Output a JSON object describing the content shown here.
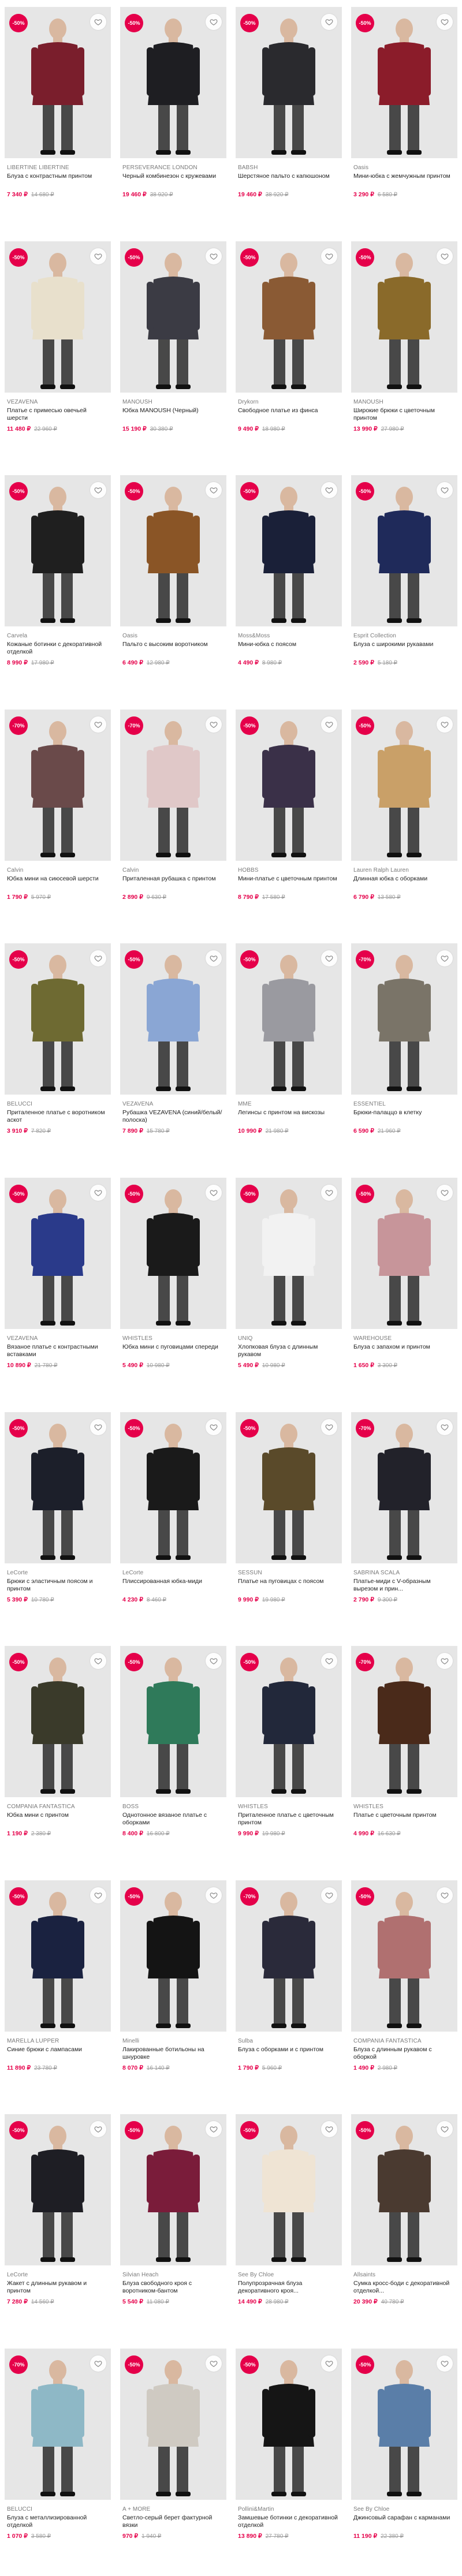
{
  "colors": {
    "accent": "#e5004a",
    "photo_bg": "#e6e6e6"
  },
  "products": [
    {
      "badge": "-50%",
      "brand": "LIBERTINE LIBERTINE",
      "title": "Блуза с контрастным принтом",
      "price": "7 340 ₽",
      "old_price": "14 680 ₽",
      "color": "#7a1e2c"
    },
    {
      "badge": "-50%",
      "brand": "PERSEVERANCE LONDON",
      "title": "Черный комбинезон с кружевами",
      "price": "19 460 ₽",
      "old_price": "38 920 ₽",
      "color": "#1e1e22"
    },
    {
      "badge": "-50%",
      "brand": "BABSH",
      "title": "Шерстяное пальто с капюшоном",
      "price": "19 460 ₽",
      "old_price": "38 920 ₽",
      "color": "#2a2a2e"
    },
    {
      "badge": "-50%",
      "brand": "Oasis",
      "title": "Мини-юбка с жемчужным принтом",
      "price": "3 290 ₽",
      "old_price": "6 580 ₽",
      "color": "#8b1c2a"
    },
    {
      "badge": "-50%",
      "brand": "VEZAVENA",
      "title": "Платье с примесью овечьей шерсти",
      "price": "11 480 ₽",
      "old_price": "22 960 ₽",
      "color": "#e8e0cc"
    },
    {
      "badge": "-50%",
      "brand": "MANOUSH",
      "title": "Юбка MANOUSH (Черный)",
      "price": "15 190 ₽",
      "old_price": "30 380 ₽",
      "color": "#3b3b44"
    },
    {
      "badge": "-50%",
      "brand": "Drykorn",
      "title": "Свободное платье из финса",
      "price": "9 490 ₽",
      "old_price": "18 980 ₽",
      "color": "#8a5a34"
    },
    {
      "badge": "-50%",
      "brand": "MANOUSH",
      "title": "Широкие брюки с цветочным принтом",
      "price": "13 990 ₽",
      "old_price": "27 980 ₽",
      "color": "#8a6a2a"
    },
    {
      "badge": "-50%",
      "brand": "Carvela",
      "title": "Кожаные ботинки с декоративной отделкой",
      "price": "8 990 ₽",
      "old_price": "17 980 ₽",
      "color": "#1f1f1f"
    },
    {
      "badge": "-50%",
      "brand": "Oasis",
      "title": "Пальто с высоким воротником",
      "price": "6 490 ₽",
      "old_price": "12 980 ₽",
      "color": "#8a5526"
    },
    {
      "badge": "-50%",
      "brand": "Moss&Moss",
      "title": "Мини-юбка с поясом",
      "price": "4 490 ₽",
      "old_price": "8 980 ₽",
      "color": "#1a2038"
    },
    {
      "badge": "-50%",
      "brand": "Esprit Collection",
      "title": "Блуза с широкими рукавами",
      "price": "2 590 ₽",
      "old_price": "5 180 ₽",
      "color": "#1f2a5a"
    },
    {
      "badge": "-70%",
      "brand": "Calvin",
      "title": "Юбка мини на сиюсевой шерсти",
      "price": "1 790 ₽",
      "old_price": "5 970 ₽",
      "color": "#6a4a4a"
    },
    {
      "badge": "-70%",
      "brand": "Calvin",
      "title": "Приталенная рубашка с принтом",
      "price": "2 890 ₽",
      "old_price": "9 630 ₽",
      "color": "#e0c8c8"
    },
    {
      "badge": "-50%",
      "brand": "HOBBS",
      "title": "Мини-платье с цветочным принтом",
      "price": "8 790 ₽",
      "old_price": "17 580 ₽",
      "color": "#3a3048"
    },
    {
      "badge": "-50%",
      "brand": "Lauren Ralph Lauren",
      "title": "Длинная юбка с оборками",
      "price": "6 790 ₽",
      "old_price": "13 580 ₽",
      "color": "#c9a068"
    },
    {
      "badge": "-50%",
      "brand": "BELUCCI",
      "title": "Приталенное платье с воротником аскот",
      "price": "3 910 ₽",
      "old_price": "7 820 ₽",
      "color": "#6e6a32"
    },
    {
      "badge": "-50%",
      "brand": "VEZAVENA",
      "title": "Рубашка VEZAVENA (синий/белый/полоска)",
      "price": "7 890 ₽",
      "old_price": "15 780 ₽",
      "color": "#8aa6d4"
    },
    {
      "badge": "-50%",
      "brand": "MME",
      "title": "Легинсы с принтом на вискозы",
      "price": "10 990 ₽",
      "old_price": "21 980 ₽",
      "color": "#9a9aa0"
    },
    {
      "badge": "-70%",
      "brand": "ESSENTIEL",
      "title": "Брюки-палаццо в клетку",
      "price": "6 590 ₽",
      "old_price": "21 960 ₽",
      "color": "#7a7468"
    },
    {
      "badge": "-50%",
      "brand": "VEZAVENA",
      "title": "Вязаное платье с контрастными вставками",
      "price": "10 890 ₽",
      "old_price": "21 780 ₽",
      "color": "#2a3a8a"
    },
    {
      "badge": "-50%",
      "brand": "WHISTLES",
      "title": "Юбка мини с пуговицами спереди",
      "price": "5 490 ₽",
      "old_price": "10 980 ₽",
      "color": "#1a1a1a"
    },
    {
      "badge": "-50%",
      "brand": "UNIQ",
      "title": "Хлопковая блуза с длинным рукавом",
      "price": "5 490 ₽",
      "old_price": "10 980 ₽",
      "color": "#f2f2f2"
    },
    {
      "badge": "-50%",
      "brand": "WAREHOUSE",
      "title": "Блуза с запахом и принтом",
      "price": "1 650 ₽",
      "old_price": "3 300 ₽",
      "color": "#c7959a"
    },
    {
      "badge": "-50%",
      "brand": "LeCorte",
      "title": "Брюки с эластичным поясом и принтом",
      "price": "5 390 ₽",
      "old_price": "10 780 ₽",
      "color": "#1c1f2a"
    },
    {
      "badge": "-50%",
      "brand": "LeCorte",
      "title": "Плиссированная юбка-миди",
      "price": "4 230 ₽",
      "old_price": "8 460 ₽",
      "color": "#1a1a1a"
    },
    {
      "badge": "-50%",
      "brand": "SESSUN",
      "title": "Платье на пуговицах с поясом",
      "price": "9 990 ₽",
      "old_price": "19 980 ₽",
      "color": "#5a4a2a"
    },
    {
      "badge": "-70%",
      "brand": "SABRINA SCALA",
      "title": "Платье-миди с V-образным вырезом и прин...",
      "price": "2 790 ₽",
      "old_price": "9 300 ₽",
      "color": "#22222a"
    },
    {
      "badge": "-50%",
      "brand": "COMPANIA FANTASTICA",
      "title": "Юбка мини с принтом",
      "price": "1 190 ₽",
      "old_price": "2 380 ₽",
      "color": "#3a3a2a"
    },
    {
      "badge": "-50%",
      "brand": "BOSS",
      "title": "Однотонное вязаное платье с оборками",
      "price": "8 400 ₽",
      "old_price": "16 800 ₽",
      "color": "#2f7a5a"
    },
    {
      "badge": "-50%",
      "brand": "WHISTLES",
      "title": "Приталенное платье с цветочным принтом",
      "price": "9 990 ₽",
      "old_price": "19 980 ₽",
      "color": "#22283a"
    },
    {
      "badge": "-70%",
      "brand": "WHISTLES",
      "title": "Платье с цветочным принтом",
      "price": "4 990 ₽",
      "old_price": "16 630 ₽",
      "color": "#4a2a1a"
    },
    {
      "badge": "-50%",
      "brand": "MARELLA LUPPER",
      "title": "Синие брюки с лампасами",
      "price": "11 890 ₽",
      "old_price": "23 780 ₽",
      "color": "#1a2240"
    },
    {
      "badge": "-50%",
      "brand": "Minelli",
      "title": "Лакированные ботильоны на шнуровке",
      "price": "8 070 ₽",
      "old_price": "16 140 ₽",
      "color": "#141414"
    },
    {
      "badge": "-70%",
      "brand": "Sulba",
      "title": "Блуза с оборками и с принтом",
      "price": "1 790 ₽",
      "old_price": "5 960 ₽",
      "color": "#2a2a3a"
    },
    {
      "badge": "-50%",
      "brand": "COMPANIA FANTASTICA",
      "title": "Блуза с длинным рукавом с оборкой",
      "price": "1 490 ₽",
      "old_price": "2 980 ₽",
      "color": "#b07070"
    },
    {
      "badge": "-50%",
      "brand": "LeCorte",
      "title": "Жакет с длинным рукавом и принтом",
      "price": "7 280 ₽",
      "old_price": "14 560 ₽",
      "color": "#1e1e24"
    },
    {
      "badge": "-50%",
      "brand": "Silvian Heach",
      "title": "Блуза свободного кроя с воротником-бантом",
      "price": "5 540 ₽",
      "old_price": "11 080 ₽",
      "color": "#7a1c3a"
    },
    {
      "badge": "-50%",
      "brand": "See By Chloe",
      "title": "Полупрозрачная блуза декоративного кроя...",
      "price": "14 490 ₽",
      "old_price": "28 980 ₽",
      "color": "#efe4d4"
    },
    {
      "badge": "-50%",
      "brand": "Allsaints",
      "title": "Сумка кросс-боди с декоративной отделкой...",
      "price": "20 390 ₽",
      "old_price": "40 780 ₽",
      "color": "#4a3a30"
    },
    {
      "badge": "-70%",
      "brand": "BELUCCI",
      "title": "Блуза с металлизированной отделкой",
      "price": "1 070 ₽",
      "old_price": "3 580 ₽",
      "color": "#8eb8c6"
    },
    {
      "badge": "-50%",
      "brand": "A + MORE",
      "title": "Светло-серый берет фактурной вязки",
      "price": "970 ₽",
      "old_price": "1 940 ₽",
      "color": "#cfcac2"
    },
    {
      "badge": "-50%",
      "brand": "Pollini&Martin",
      "title": "Замшевые ботинки с декоративной отделкой",
      "price": "13 890 ₽",
      "old_price": "27 780 ₽",
      "color": "#151515"
    },
    {
      "badge": "-50%",
      "brand": "See By Chloe",
      "title": "Джинсовый сарафан с карманами",
      "price": "11 190 ₽",
      "old_price": "22 380 ₽",
      "color": "#5a7ea8"
    }
  ]
}
